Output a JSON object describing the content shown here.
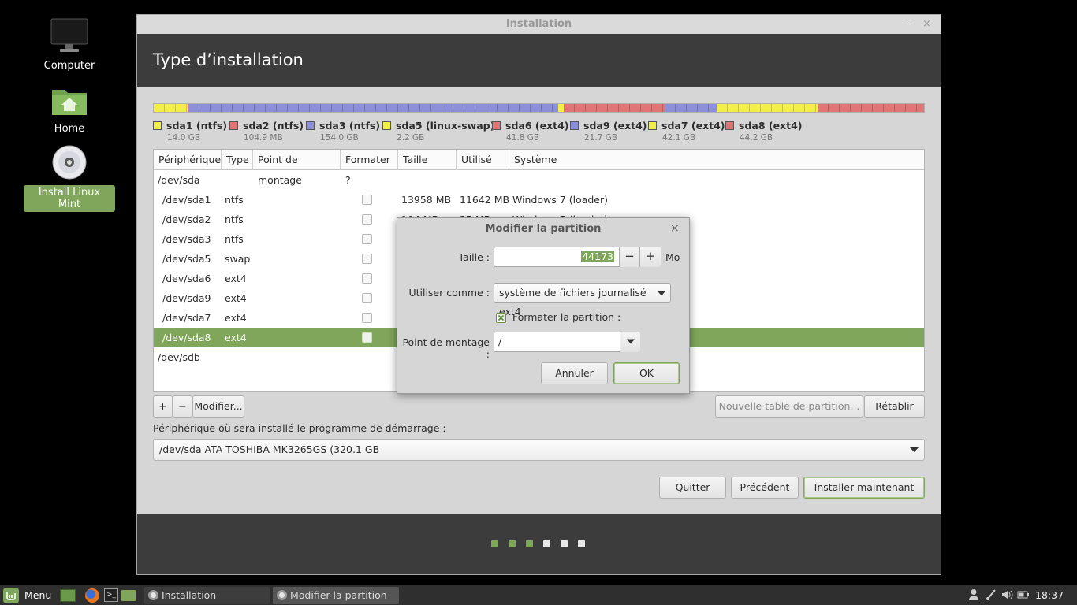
{
  "desktop": {
    "icons": [
      {
        "label": "Computer",
        "icon": "monitor-icon"
      },
      {
        "label": "Home",
        "icon": "home-folder-icon"
      },
      {
        "label": "Install Linux Mint",
        "icon": "cd-disc-icon"
      }
    ]
  },
  "window": {
    "title": "Installation",
    "minimize_glyph": "–",
    "close_glyph": "×",
    "header": "Type d’installation"
  },
  "colors": {
    "ntfs": "#d7d53a",
    "ntfs_red": "#e07575",
    "ntfs_blue": "#8b90d9",
    "swap": "#f2ee4a",
    "ext4_red": "#e07575",
    "ext4_blue": "#8b90d9",
    "ext4_yellow": "#f2ee4a",
    "accent": "#7fa65a"
  },
  "partition_bar": [
    {
      "color": "#f2ee4a",
      "fraction": 0.0437
    },
    {
      "color": "#e07575",
      "fraction": 0.001
    },
    {
      "color": "#8b90d9",
      "fraction": 0.4811
    },
    {
      "color": "#f2ee4a",
      "fraction": 0.0069
    },
    {
      "color": "#e07575",
      "fraction": 0.1306
    },
    {
      "color": "#8b90d9",
      "fraction": 0.0678
    },
    {
      "color": "#f2ee4a",
      "fraction": 0.1315
    },
    {
      "color": "#e07575",
      "fraction": 0.138
    }
  ],
  "legend": [
    {
      "name": "sda1 (ntfs)",
      "size": "14.0 GB",
      "color": "#f2ee4a"
    },
    {
      "name": "sda2 (ntfs)",
      "size": "104.9 MB",
      "color": "#e07575"
    },
    {
      "name": "sda3 (ntfs)",
      "size": "154.0 GB",
      "color": "#8b90d9"
    },
    {
      "name": "sda5 (linux-swap)",
      "size": "2.2 GB",
      "color": "#f2ee4a"
    },
    {
      "name": "sda6 (ext4)",
      "size": "41.8 GB",
      "color": "#e07575"
    },
    {
      "name": "sda9 (ext4)",
      "size": "21.7 GB",
      "color": "#8b90d9"
    },
    {
      "name": "sda7 (ext4)",
      "size": "42.1 GB",
      "color": "#f2ee4a"
    },
    {
      "name": "sda8 (ext4)",
      "size": "44.2 GB",
      "color": "#e07575"
    }
  ],
  "table": {
    "headers": [
      "Périphérique",
      "Type",
      "Point de montage",
      "Formater ?",
      "Taille",
      "Utilisé",
      "Système"
    ],
    "rows": [
      {
        "device": "/dev/sda",
        "type": "",
        "mount": "",
        "format": null,
        "size": "",
        "used": "",
        "system": "",
        "group": true
      },
      {
        "device": "/dev/sda1",
        "type": "ntfs",
        "mount": "",
        "format": false,
        "size": "13958 MB",
        "used": "11642 MB",
        "system": "Windows 7 (loader)"
      },
      {
        "device": "/dev/sda2",
        "type": "ntfs",
        "mount": "",
        "format": false,
        "size": "104 MB",
        "used": "27 MB",
        "system": "Windows 7 (loader)"
      },
      {
        "device": "/dev/sda3",
        "type": "ntfs",
        "mount": "",
        "format": false,
        "size": "",
        "used": "",
        "system": ""
      },
      {
        "device": "/dev/sda5",
        "type": "swap",
        "mount": "",
        "format": false,
        "size": "",
        "used": "",
        "system": ""
      },
      {
        "device": "/dev/sda6",
        "type": "ext4",
        "mount": "",
        "format": false,
        "size": "",
        "used": "",
        "system": ""
      },
      {
        "device": "/dev/sda9",
        "type": "ext4",
        "mount": "",
        "format": false,
        "size": "",
        "used": "",
        "system": ""
      },
      {
        "device": "/dev/sda7",
        "type": "ext4",
        "mount": "",
        "format": false,
        "size": "",
        "used": "",
        "system": ""
      },
      {
        "device": "/dev/sda8",
        "type": "ext4",
        "mount": "",
        "format": false,
        "size": "",
        "used": "",
        "system": "",
        "selected": true
      },
      {
        "device": "/dev/sdb",
        "type": "",
        "mount": "",
        "format": null,
        "size": "",
        "used": "",
        "system": "",
        "group": true
      }
    ]
  },
  "table_buttons": {
    "add": "+",
    "remove": "−",
    "modify": "Modifier...",
    "new_table": "Nouvelle table de partition...",
    "revert": "Rétablir"
  },
  "bootloader": {
    "label": "Périphérique où sera installé le programme de démarrage :",
    "value": "/dev/sda   ATA TOSHIBA MK3265GS (320.1 GB"
  },
  "nav_buttons": {
    "quit": "Quitter",
    "back": "Précédent",
    "install": "Installer maintenant"
  },
  "progress": {
    "total_steps": 6,
    "current_step": 3
  },
  "dialog": {
    "title": "Modifier la partition",
    "close_glyph": "×",
    "size_label": "Taille :",
    "size_value": "44173",
    "size_unit": "Mo",
    "minus": "−",
    "plus": "+",
    "use_as_label": "Utiliser comme :",
    "use_as_value": "système de fichiers journalisé ext4",
    "format_label": "Formater la partition :",
    "format_checked": true,
    "mount_label": "Point de montage :",
    "mount_value": "/",
    "cancel": "Annuler",
    "ok": "OK"
  },
  "taskbar": {
    "menu": "Menu",
    "tasks": [
      "Installation",
      "Modifier la partition"
    ],
    "clock": "18:37"
  }
}
